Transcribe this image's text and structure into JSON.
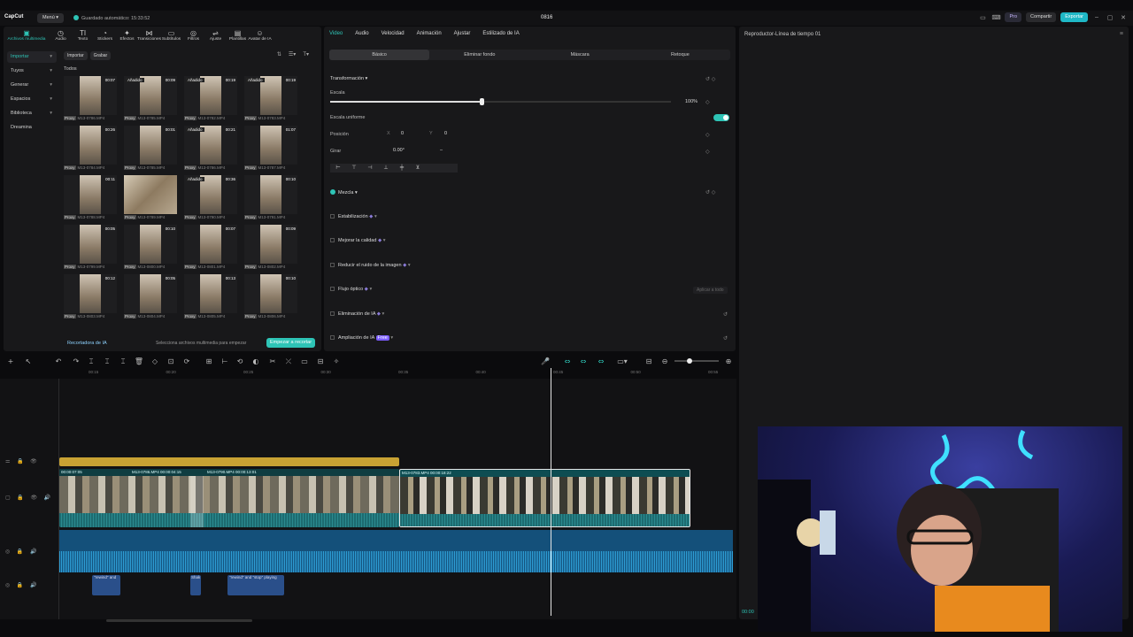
{
  "titlebar": {
    "logo": "CapCut",
    "menu": "Menú ▾",
    "autosave": "Guardado automático: 15:33:52",
    "project": "0816",
    "pro": "Pro",
    "share": "Compartir",
    "export": "Exportar"
  },
  "media": {
    "tools": [
      {
        "label": "Archivos multimedia",
        "icon": "▣"
      },
      {
        "label": "Audio",
        "icon": "◷"
      },
      {
        "label": "Texto",
        "icon": "TI"
      },
      {
        "label": "Stickers",
        "icon": "◔"
      },
      {
        "label": "Efectos",
        "icon": "✦"
      },
      {
        "label": "Transiciones",
        "icon": "⋈"
      },
      {
        "label": "Subtítulos",
        "icon": "▭"
      },
      {
        "label": "Filtros",
        "icon": "◎"
      },
      {
        "label": "Ajuste",
        "icon": "⇌"
      },
      {
        "label": "Plantillas",
        "icon": "▤"
      },
      {
        "label": "Avatar de IA",
        "icon": "☺"
      }
    ],
    "nav": [
      "Importar",
      "Tuyos",
      "Generar",
      "Espacios",
      "Biblioteca",
      "Dreamina"
    ],
    "import_btn": "Importar",
    "record_btn": "Grabar",
    "all_label": "Todos",
    "items": [
      {
        "dur": "00:07",
        "tag": "",
        "name": "M13-0786.MP4",
        "wide": false
      },
      {
        "dur": "00:09",
        "tag": "Añadido",
        "name": "M13-0785.MP4",
        "wide": false
      },
      {
        "dur": "00:19",
        "tag": "Añadido",
        "name": "M13-0782.MP4",
        "wide": false
      },
      {
        "dur": "00:19",
        "tag": "Añadido",
        "name": "M13-0783.MP4",
        "wide": false
      },
      {
        "dur": "00:26",
        "tag": "",
        "name": "M13-0784.MP4",
        "wide": false
      },
      {
        "dur": "00:01",
        "tag": "",
        "name": "M13-0785.MP4",
        "wide": false
      },
      {
        "dur": "00:21",
        "tag": "Añadido",
        "name": "M13-0786.MP4",
        "wide": false
      },
      {
        "dur": "01:07",
        "tag": "",
        "name": "M13-0787.MP4",
        "wide": false
      },
      {
        "dur": "00:11",
        "tag": "",
        "name": "M13-0788.MP4",
        "wide": false
      },
      {
        "dur": "",
        "tag": "",
        "name": "M13-0789.MP4",
        "wide": true
      },
      {
        "dur": "00:36",
        "tag": "Añadido",
        "name": "M13-0790.MP4",
        "wide": false
      },
      {
        "dur": "00:10",
        "tag": "",
        "name": "M13-0791.MP4",
        "wide": false
      },
      {
        "dur": "00:05",
        "tag": "",
        "name": "M13-0799.MP4",
        "wide": false
      },
      {
        "dur": "00:10",
        "tag": "",
        "name": "M13-0800.MP4",
        "wide": false
      },
      {
        "dur": "00:07",
        "tag": "",
        "name": "M13-0801.MP4",
        "wide": false
      },
      {
        "dur": "00:09",
        "tag": "",
        "name": "M13-0802.MP4",
        "wide": false
      },
      {
        "dur": "00:12",
        "tag": "",
        "name": "M13-0803.MP4",
        "wide": false
      },
      {
        "dur": "00:05",
        "tag": "",
        "name": "M13-0804.MP4",
        "wide": false
      },
      {
        "dur": "00:13",
        "tag": "",
        "name": "M13-0805.MP4",
        "wide": false
      },
      {
        "dur": "00:10",
        "tag": "",
        "name": "M13-0806.MP4",
        "wide": false
      }
    ],
    "proxy": "Proxy",
    "ai_recorder": "Recortadora de IA",
    "select_hint": "Selecciona archivos multimedia para empezar",
    "start_btn": "Empezar a recortar"
  },
  "props": {
    "tabs": [
      "Video",
      "Audio",
      "Velocidad",
      "Animación",
      "Ajustar",
      "Estilizado de IA"
    ],
    "subtabs": [
      "Básico",
      "Eliminar fondo",
      "Máscara",
      "Retoque"
    ],
    "transform": "Transformación ▾",
    "scale": "Escala",
    "scale_value": 1.0,
    "scale_pct": "100%",
    "uniform": "Escala uniforme",
    "position": "Posición",
    "pos_x_label": "X",
    "pos_x": "0",
    "pos_y_label": "Y",
    "pos_y": "0",
    "rotate": "Girar",
    "rotate_val": "0.00°",
    "blend": "Mezcla ▾",
    "sections": [
      "Estabilización",
      "Mejorar la calidad",
      "Reducir el ruido de la imagen",
      "Flujo óptico",
      "Eliminación de IA",
      "Ampliación de IA"
    ],
    "apply_all": "Aplicar a todo",
    "free_badge": "Free"
  },
  "player": {
    "title": "Reproductor-Línea de tiempo 01",
    "time": "00:00"
  },
  "timeline": {
    "ruler": [
      "00:15",
      "00:20",
      "00:25",
      "00:30",
      "00:35",
      "00:40",
      "00:45",
      "00:50",
      "00:55"
    ],
    "clip1": "00:00:07:05",
    "clip2": "M13-0786.MP4  00:00:04:15",
    "clip3": "M13-0790.MP4  00:00:13:01",
    "clip4": "M13-0783.MP4  00:00:18:22",
    "sfx": [
      "\"rewind\" and",
      "Shak",
      "\"rewind\" and \"stop\" playing"
    ]
  }
}
